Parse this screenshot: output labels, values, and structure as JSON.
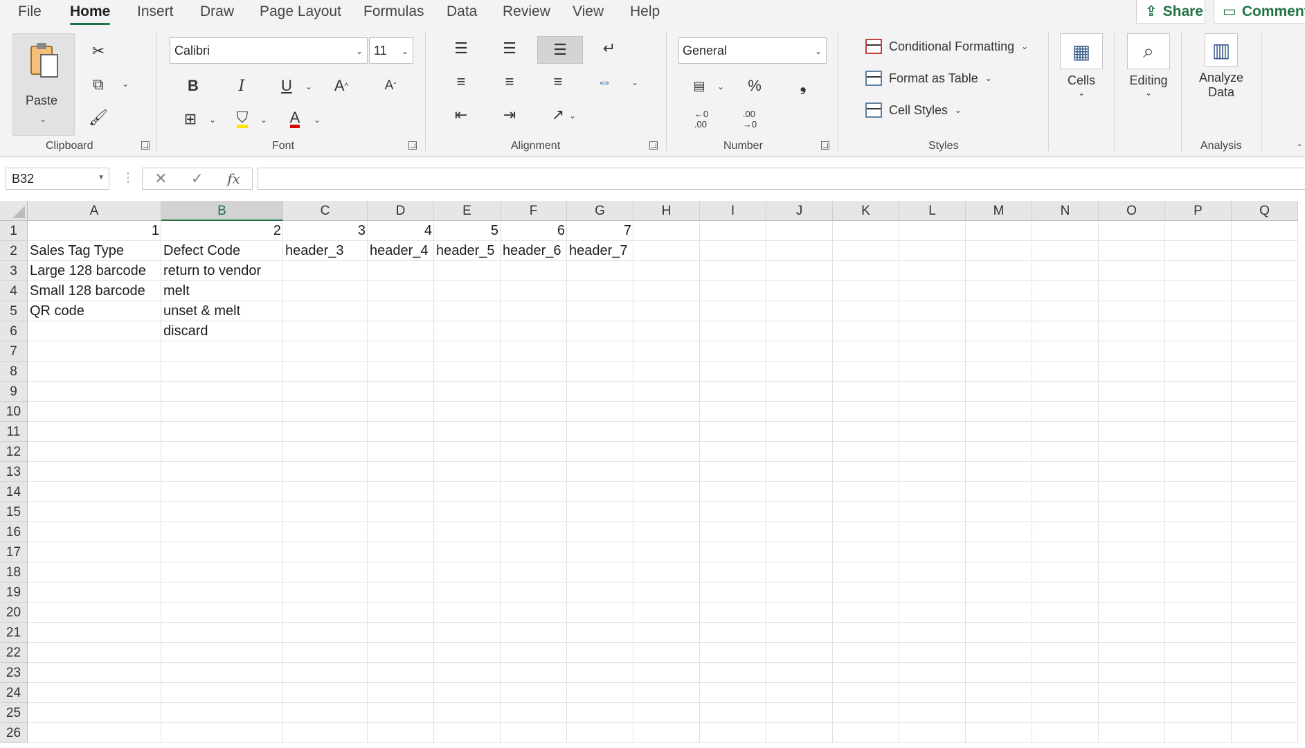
{
  "tabs": [
    "File",
    "Home",
    "Insert",
    "Draw",
    "Page Layout",
    "Formulas",
    "Data",
    "Review",
    "View",
    "Help"
  ],
  "active_tab": "Home",
  "share_label": "Share",
  "comments_label": "Comments",
  "ribbon": {
    "clipboard": {
      "group_label": "Clipboard",
      "paste_label": "Paste"
    },
    "font": {
      "group_label": "Font",
      "font_name": "Calibri",
      "font_size": "11"
    },
    "alignment": {
      "group_label": "Alignment"
    },
    "number": {
      "group_label": "Number",
      "format": "General"
    },
    "styles": {
      "group_label": "Styles",
      "conditional_formatting": "Conditional Formatting",
      "format_as_table": "Format as Table",
      "cell_styles": "Cell Styles"
    },
    "cells": {
      "label": "Cells"
    },
    "editing": {
      "label": "Editing"
    },
    "analysis": {
      "group_label": "Analysis",
      "analyze_line1": "Analyze",
      "analyze_line2": "Data"
    }
  },
  "formula_bar": {
    "name_box": "B32",
    "formula": ""
  },
  "sheet": {
    "selected_column": "B",
    "columns": [
      "A",
      "B",
      "C",
      "D",
      "E",
      "F",
      "G",
      "H",
      "I",
      "J",
      "K",
      "L",
      "M",
      "N",
      "O",
      "P",
      "Q"
    ],
    "rows": [
      "1",
      "2",
      "3",
      "4",
      "5",
      "6",
      "7",
      "8",
      "9",
      "10",
      "11",
      "12",
      "13",
      "14",
      "15",
      "16",
      "17",
      "18",
      "19",
      "20",
      "21",
      "22",
      "23",
      "24",
      "25",
      "26"
    ],
    "cells": {
      "A1": "1",
      "B1": "2",
      "C1": "3",
      "D1": "4",
      "E1": "5",
      "F1": "6",
      "G1": "7",
      "A2": "Sales Tag Type",
      "B2": "Defect Code",
      "C2": "header_3",
      "D2": "header_4",
      "E2": "header_5",
      "F2": "header_6",
      "G2": "header_7",
      "A3": "Large 128 barcode",
      "B3": "return to vendor",
      "A4": "Small 128 barcode",
      "B4": "melt",
      "A5": "QR code",
      "B5": "unset & melt",
      "B6": "discard"
    }
  },
  "colors": {
    "accent": "#217346",
    "ribbon_bg": "#f3f3f3",
    "gridline": "#e1e1e1",
    "header_bg": "#e6e6e6"
  }
}
